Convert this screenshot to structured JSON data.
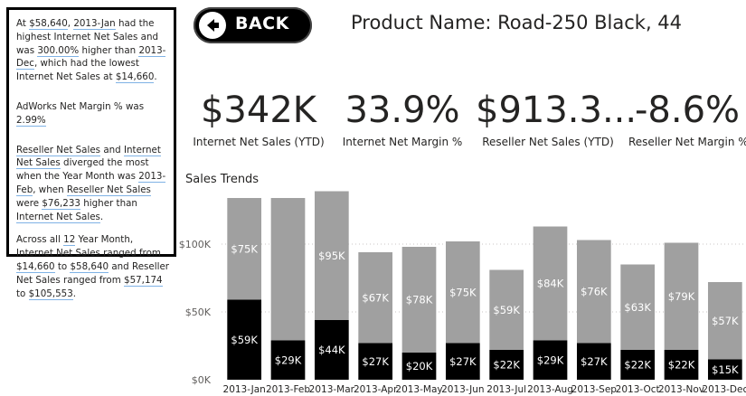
{
  "narrative": {
    "p1": [
      {
        "t": "At "
      },
      {
        "t": "$58,640",
        "hl": true
      },
      {
        "t": ", "
      },
      {
        "t": "2013-Jan",
        "hl": true
      },
      {
        "t": " had the highest Internet Net Sales and was "
      },
      {
        "t": "300.00%",
        "hl": true
      },
      {
        "t": " higher than "
      },
      {
        "t": "2013-Dec",
        "hl": true
      },
      {
        "t": ", which had the lowest Internet Net Sales at "
      },
      {
        "t": "$14,660",
        "hl": true
      },
      {
        "t": "."
      }
    ],
    "p2": [
      {
        "t": "AdWorks Net Margin % was "
      },
      {
        "t": "2.99%",
        "hl": true
      }
    ],
    "p3": [
      {
        "t": "Reseller Net Sales",
        "hl": true
      },
      {
        "t": " and "
      },
      {
        "t": "Internet Net Sales",
        "hl": true
      },
      {
        "t": " diverged the most when the Year Month was "
      },
      {
        "t": "2013-Feb",
        "hl": true
      },
      {
        "t": ", when "
      },
      {
        "t": "Reseller Net Sales",
        "hl": true
      },
      {
        "t": " were "
      },
      {
        "t": "$76,233",
        "hl": true
      },
      {
        "t": " higher than "
      },
      {
        "t": "Internet Net Sales",
        "hl": true
      },
      {
        "t": "."
      }
    ],
    "p4": [
      {
        "t": "Across all "
      },
      {
        "t": "12",
        "hl": true
      },
      {
        "t": " Year Month, Internet Net Sales ranged from "
      },
      {
        "t": "$14,660",
        "hl": true
      },
      {
        "t": " to "
      },
      {
        "t": "$58,640",
        "hl": true
      },
      {
        "t": " and Reseller Net Sales ranged from "
      },
      {
        "t": "$57,174",
        "hl": true
      },
      {
        "t": " to "
      },
      {
        "t": "$105,553",
        "hl": true
      },
      {
        "t": "."
      }
    ]
  },
  "back_button": {
    "label": "BACK",
    "icon": "arrow-left-icon"
  },
  "product_name": "Product Name: Road-250 Black, 44",
  "kpis": [
    {
      "value": "$342K",
      "caption": "Internet Net Sales (YTD)"
    },
    {
      "value": "33.9%",
      "caption": "Internet Net Margin %"
    },
    {
      "value": "$913.3...",
      "caption": "Reseller Net Sales (YTD)"
    },
    {
      "value": "-8.6%",
      "caption": "Reseller Net Margin %"
    }
  ],
  "colors": {
    "internet": "#000000",
    "reseller": "#a0a0a0",
    "border": "#000000",
    "link_underline": "#7fb2e5"
  },
  "chart_data": {
    "type": "bar",
    "stacked": true,
    "title": "Sales Trends",
    "categories": [
      "2013-Jan",
      "2013-Feb",
      "2013-Mar",
      "2013-Apr",
      "2013-May",
      "2013-Jun",
      "2013-Jul",
      "2013-Aug",
      "2013-Sep",
      "2013-Oct",
      "2013-Nov",
      "2013-Dec"
    ],
    "series": [
      {
        "values": [
          59,
          29,
          44,
          27,
          20,
          27,
          22,
          29,
          27,
          22,
          22,
          15
        ],
        "labels": [
          "$59K",
          "$29K",
          "$44K",
          "$27K",
          "$20K",
          "$27K",
          "$22K",
          "$29K",
          "$27K",
          "$22K",
          "$22K",
          "$15K"
        ],
        "color": "#000000"
      },
      {
        "values": [
          75,
          105,
          95,
          67,
          78,
          75,
          59,
          84,
          76,
          63,
          79,
          57
        ],
        "labels": [
          "$75K",
          "",
          "$95K",
          "$67K",
          "$78K",
          "$75K",
          "$59K",
          "$84K",
          "$76K",
          "$63K",
          "$79K",
          "$57K"
        ],
        "color": "#a0a0a0"
      }
    ],
    "y_ticks": [
      "$0K",
      "$50K",
      "$100K"
    ],
    "y_tick_values": [
      0,
      50,
      100
    ],
    "ylim": [
      0,
      140
    ],
    "grid": true
  }
}
